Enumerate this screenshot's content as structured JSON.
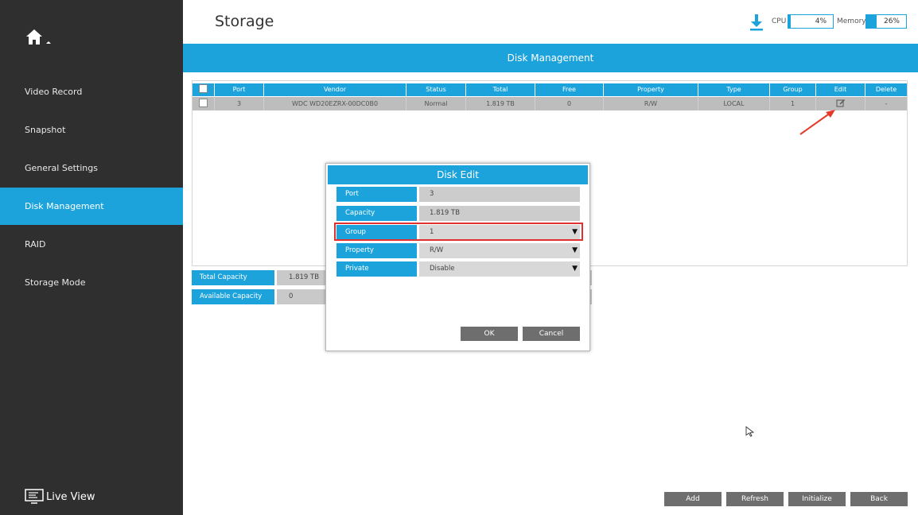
{
  "sidebar": {
    "items": [
      {
        "label": "Video Record"
      },
      {
        "label": "Snapshot"
      },
      {
        "label": "General Settings"
      },
      {
        "label": "Disk Management"
      },
      {
        "label": "RAID"
      },
      {
        "label": "Storage Mode"
      }
    ],
    "live_view": "Live View"
  },
  "header": {
    "title": "Storage",
    "cpu_label": "CPU",
    "cpu_value": "4%",
    "cpu_percent": 4,
    "memory_label": "Memory",
    "memory_value": "26%",
    "memory_percent": 26
  },
  "section": {
    "title": "Disk Management"
  },
  "table": {
    "columns": [
      "Port",
      "Vendor",
      "Status",
      "Total",
      "Free",
      "Property",
      "Type",
      "Group",
      "Edit",
      "Delete"
    ],
    "rows": [
      {
        "port": "3",
        "vendor": "WDC WD20EZRX-00DC0B0",
        "status": "Normal",
        "total": "1.819 TB",
        "free": "0",
        "property": "R/W",
        "type": "LOCAL",
        "group": "1",
        "delete": "-"
      }
    ]
  },
  "capacity": {
    "total_label": "Total Capacity",
    "total_value": "1.819 TB",
    "available_label": "Available Capacity",
    "available_value": "0"
  },
  "buttons": {
    "add": "Add",
    "refresh": "Refresh",
    "initialize": "Initialize",
    "back": "Back"
  },
  "dialog": {
    "title": "Disk Edit",
    "fields": {
      "port_label": "Port",
      "port_value": "3",
      "capacity_label": "Capacity",
      "capacity_value": "1.819 TB",
      "group_label": "Group",
      "group_value": "1",
      "property_label": "Property",
      "property_value": "R/W",
      "private_label": "Private",
      "private_value": "Disable"
    },
    "ok": "OK",
    "cancel": "Cancel"
  },
  "colors": {
    "accent": "#1ca3dc",
    "sidebar": "#2f2f2f",
    "highlight": "#e03030"
  }
}
